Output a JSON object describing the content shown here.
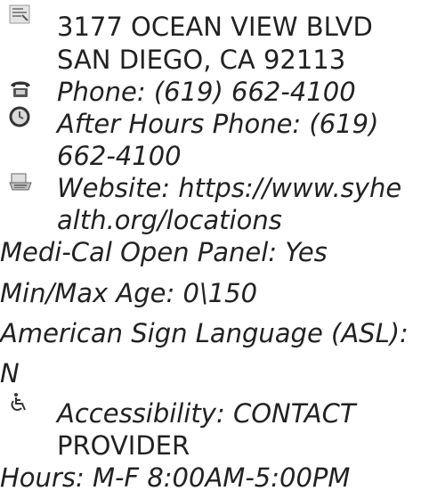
{
  "address": {
    "line1": "3177 OCEAN VIEW BLVD",
    "line2": "SAN DIEGO, CA 92113"
  },
  "phone": {
    "label": "Phone: (619) 662-4100",
    "icon": "phone-icon"
  },
  "after_hours": {
    "line1": "After Hours Phone: (619)",
    "line2": "662-4100",
    "icon": "clock-icon"
  },
  "website": {
    "line1": "Website: https://www.syhe",
    "line2": "alth.org/locations",
    "icon": "web-icon"
  },
  "medi_cal": "Medi-Cal Open Panel: Yes",
  "age": "Min/Max Age: 0\\150",
  "asl": {
    "line1": "American Sign Language (ASL):",
    "line2": "N"
  },
  "accessibility": {
    "line1": "Accessibility: CONTACT",
    "line2": "PROVIDER",
    "icon": "wheelchair-icon"
  },
  "hours": "Hours: M-F 8:00AM-5:00PM"
}
